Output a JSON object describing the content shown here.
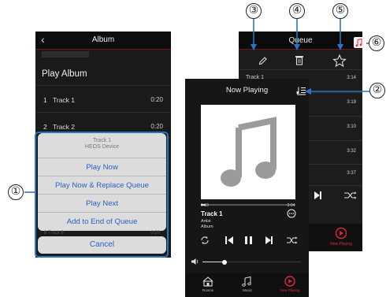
{
  "album_screen": {
    "title": "Album",
    "back_glyph": "‹",
    "play_album": "Play Album",
    "tracks": [
      {
        "number": "1",
        "name": "Track 1",
        "duration": "0:20"
      },
      {
        "number": "2",
        "name": "Track 2",
        "duration": "0:20"
      }
    ],
    "hidden_row": {
      "name": "8 Track 8",
      "duration": "0:20"
    }
  },
  "action_sheet": {
    "header_line1": "Track 1",
    "header_line2": "HEOS Device",
    "options": [
      "Play Now",
      "Play Now & Replace Queue",
      "Play Next",
      "Add to End of Queue"
    ],
    "cancel": "Cancel"
  },
  "queue_screen": {
    "title": "Queue",
    "rows": [
      {
        "name": "Track 1",
        "duration": "3:14"
      },
      {
        "name": "",
        "duration": "3:19"
      },
      {
        "name": "",
        "duration": "3:10"
      },
      {
        "name": "",
        "duration": "3:32"
      },
      {
        "name": "",
        "duration": "3:37"
      }
    ],
    "bottom_tab_label": "Now Playing"
  },
  "now_playing": {
    "title": "Now Playing",
    "elapsed": "0:10",
    "remaining": "-3:04",
    "track": "Track 1",
    "artist": "Artist",
    "album": "Album",
    "progress_fraction": 0.05,
    "volume_fraction": 0.22,
    "tabs": [
      {
        "label": "Rooms",
        "icon": "rooms-icon"
      },
      {
        "label": "Music",
        "icon": "music-icon"
      },
      {
        "label": "Now Playing",
        "icon": "play-circle-icon"
      }
    ]
  },
  "callouts": [
    "①",
    "②",
    "③",
    "④",
    "⑤",
    "⑥"
  ],
  "colors": {
    "accent_red": "#e0283a",
    "sheet_blue": "#2a62c2",
    "callout_border": "#2a74c4"
  }
}
